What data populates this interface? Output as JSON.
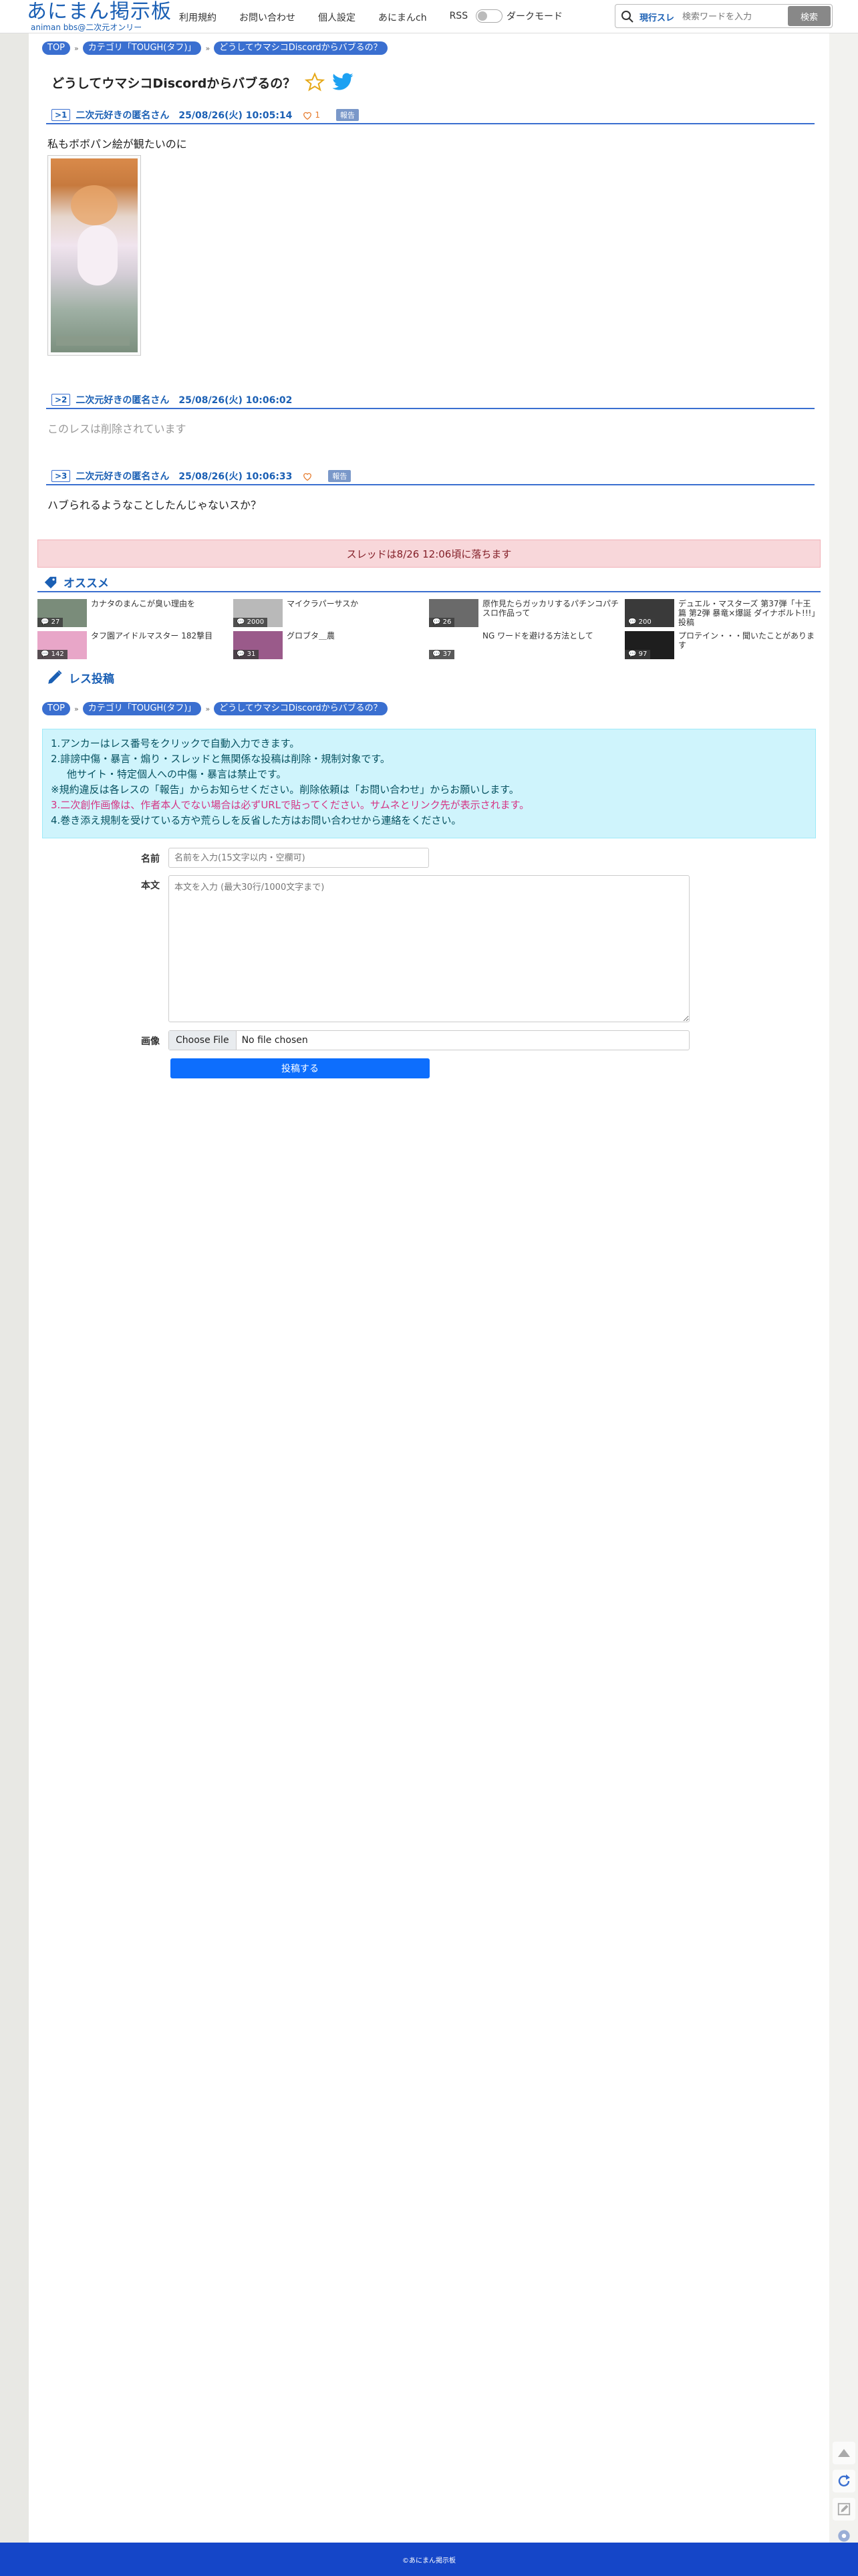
{
  "header": {
    "logo_main": "あにまん掲示板",
    "logo_sub": "animan bbs@二次元オンリー",
    "nav": [
      "利用規約",
      "お問い合わせ",
      "個人設定",
      "あにまんch",
      "RSS"
    ],
    "dark_mode_label": "ダークモード",
    "search_scope": "現行スレ",
    "search_placeholder": "検索ワードを入力",
    "search_button": "検索"
  },
  "breadcrumbs": [
    "TOP",
    "カテゴリ「TOUGH(タフ)」",
    "どうしてウマシコDiscordからバブるの？"
  ],
  "thread_title": "どうしてウマシコDiscordからバブるの？",
  "posts": [
    {
      "no": ">1",
      "name": "二次元好きの匿名さん",
      "date": "25/08/26(火) 10:05:14",
      "likes": "1",
      "report": "報告",
      "body": "私もボボパン絵が観たいのに"
    },
    {
      "no": ">2",
      "name": "二次元好きの匿名さん",
      "date": "25/08/26(火) 10:06:02",
      "body": "このレスは削除されています"
    },
    {
      "no": ">3",
      "name": "二次元好きの匿名さん",
      "date": "25/08/26(火) 10:06:33",
      "report": "報告",
      "body": "ハブられるようなことしたんじゃないスか？"
    }
  ],
  "expire_notice": "スレッドは8/26 12:06頃に落ちます",
  "recommend": {
    "heading": "オススメ",
    "items": [
      {
        "title": "カナタのまんこが臭い理由を",
        "count": "27"
      },
      {
        "title": "マイクラパーサスか",
        "count": "2000"
      },
      {
        "title": "原作見たらガッカリするパチンコパチスロ作品って",
        "count": "26"
      },
      {
        "title": "デュエル・マスターズ 第37弾「十王篇 第2弾 暴竜×爆誕 ダイナボルト!!!」投稿",
        "count": "200"
      },
      {
        "title": "タフ園アイドルマスター 182撃目",
        "count": "142"
      },
      {
        "title": "グロブタ＿農",
        "count": "31"
      },
      {
        "title": "NG ワードを避ける方法として",
        "count": "37"
      },
      {
        "title": "プロテイン・・・聞いたことがあります",
        "count": "97"
      }
    ]
  },
  "post_form": {
    "heading": "レス投稿",
    "rules": [
      "1.アンカーはレス番号をクリックで自動入力できます。",
      "2.誹謗中傷・暴言・煽り・スレッドと無関係な投稿は削除・規制対象です。",
      "他サイト・特定個人への中傷・暴言は禁止です。",
      "※規約違反は各レスの「報告」からお知らせください。削除依頼は「お問い合わせ」からお願いします。",
      "3.二次創作画像は、作者本人でない場合は必ずURLで貼ってください。サムネとリンク先が表示されます。",
      "4.巻き添え規制を受けている方や荒らしを反省した方はお問い合わせから連絡をください。"
    ],
    "name_label": "名前",
    "name_placeholder": "名前を入力(15文字以内・空欄可)",
    "body_label": "本文",
    "body_placeholder": "本文を入力 (最大30行/1000文字まで)",
    "image_label": "画像",
    "file_button": "Choose File",
    "file_name": "No file chosen",
    "submit": "投稿する"
  },
  "footer": "©あにまん掲示板",
  "colors": {
    "brand": "#1a5fb4",
    "accent": "#3a6fd0",
    "footer": "#1546c8",
    "banner_bg": "#f8d7da",
    "info_bg": "#cff4fc"
  }
}
